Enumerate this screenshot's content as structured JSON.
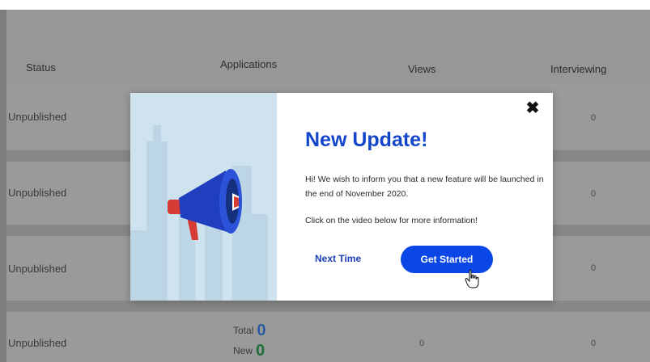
{
  "table": {
    "headers": {
      "status": "Status",
      "applications": "Applications",
      "views": "Views",
      "interviewing": "Interviewing"
    },
    "rows": [
      {
        "status": "Unpublished",
        "interviewing": "0"
      },
      {
        "status": "Unpublished",
        "interviewing": "0"
      },
      {
        "status": "Unpublished",
        "interviewing": "0"
      },
      {
        "status": "Unpublished",
        "views": "0",
        "interviewing": "0",
        "total_label": "Total",
        "total_value": "0",
        "new_label": "New",
        "new_value": "0"
      }
    ]
  },
  "modal": {
    "title": "New Update!",
    "message": "Hi! We wish to inform you that a new feature will be launched in the end of November 2020.",
    "message2": "Click on the video below for more information!",
    "next_label": "Next Time",
    "get_started_label": "Get Started",
    "close_glyph": "✖"
  },
  "colors": {
    "accent": "#0a47e6",
    "title": "#1446c9",
    "megaphone": "#1f3fbf",
    "illustration_bg": "#cfe3ee"
  },
  "icons": [
    "megaphone-icon",
    "close-icon",
    "hand-cursor-icon"
  ]
}
